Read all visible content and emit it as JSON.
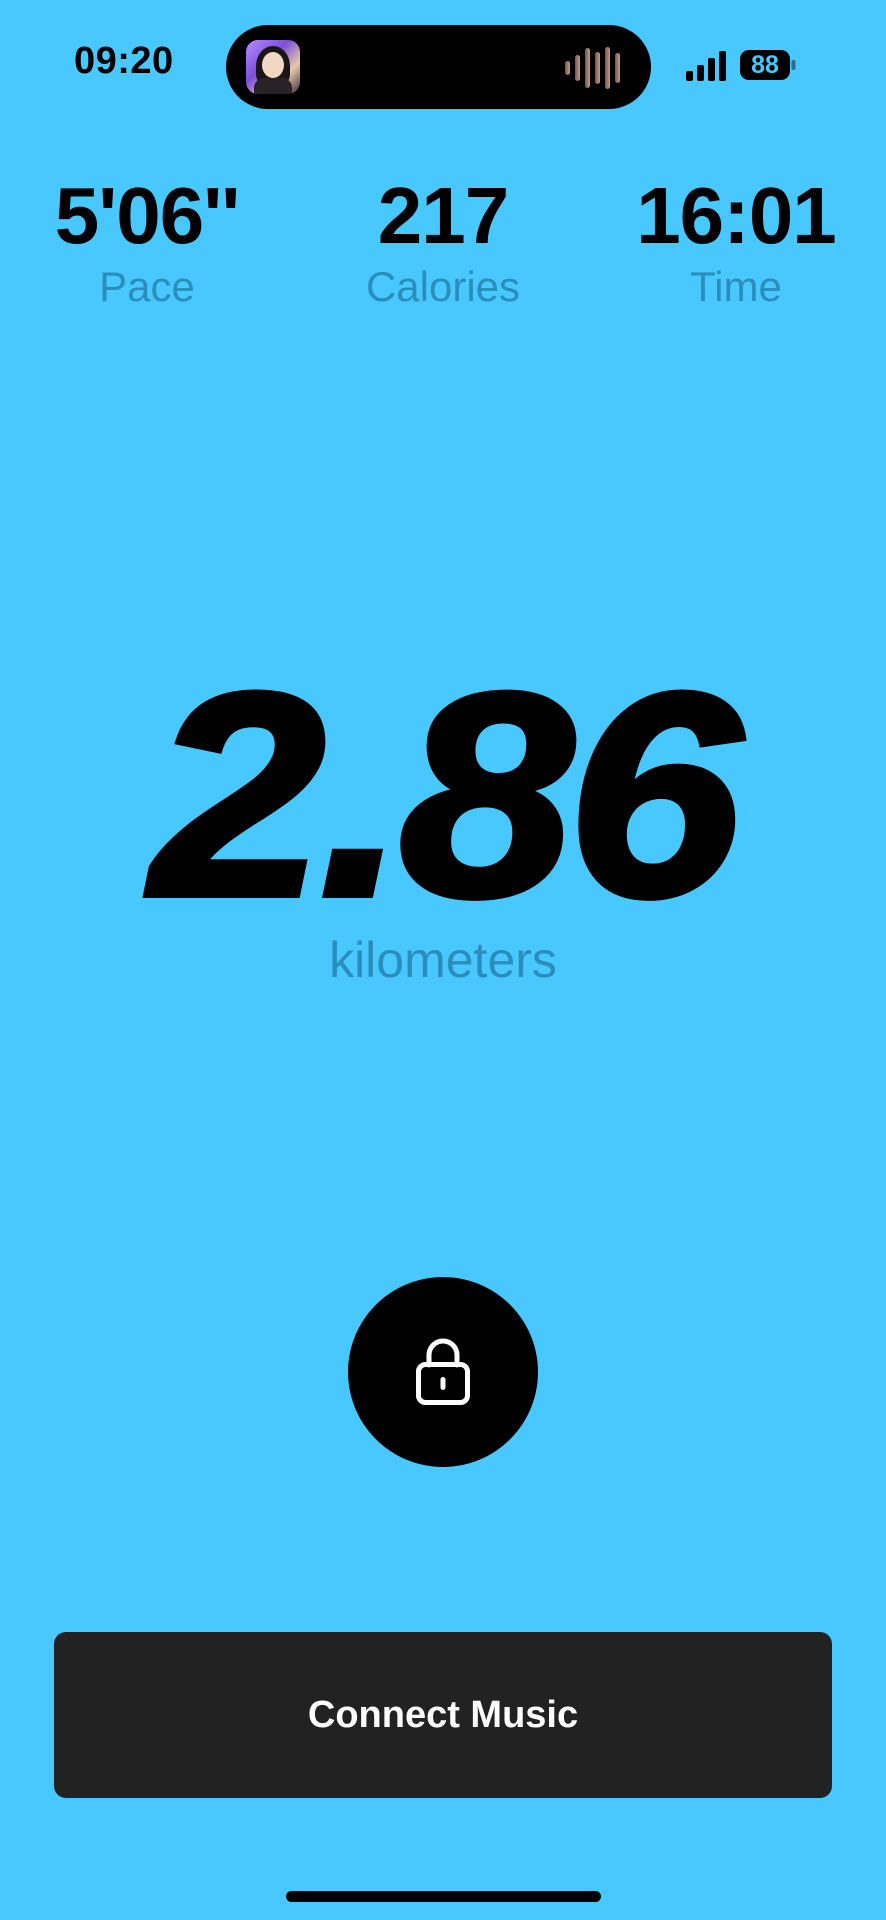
{
  "status_bar": {
    "time": "09:20",
    "battery": "88",
    "icons": [
      "now-playing-artwork",
      "audio-waveform-icon",
      "cellular-signal-icon",
      "battery-icon"
    ]
  },
  "stats": {
    "pace": {
      "value": "5'06''",
      "label": "Pace"
    },
    "calories": {
      "value": "217",
      "label": "Calories"
    },
    "time": {
      "value": "16:01",
      "label": "Time"
    }
  },
  "distance": {
    "value": "2.86",
    "unit": "kilometers"
  },
  "lock": {
    "icon": "lock-icon"
  },
  "music": {
    "label": "Connect Music"
  },
  "colors": {
    "background": "#48c8ff",
    "label": "#2a8ebd",
    "button_dark": "#222222"
  }
}
